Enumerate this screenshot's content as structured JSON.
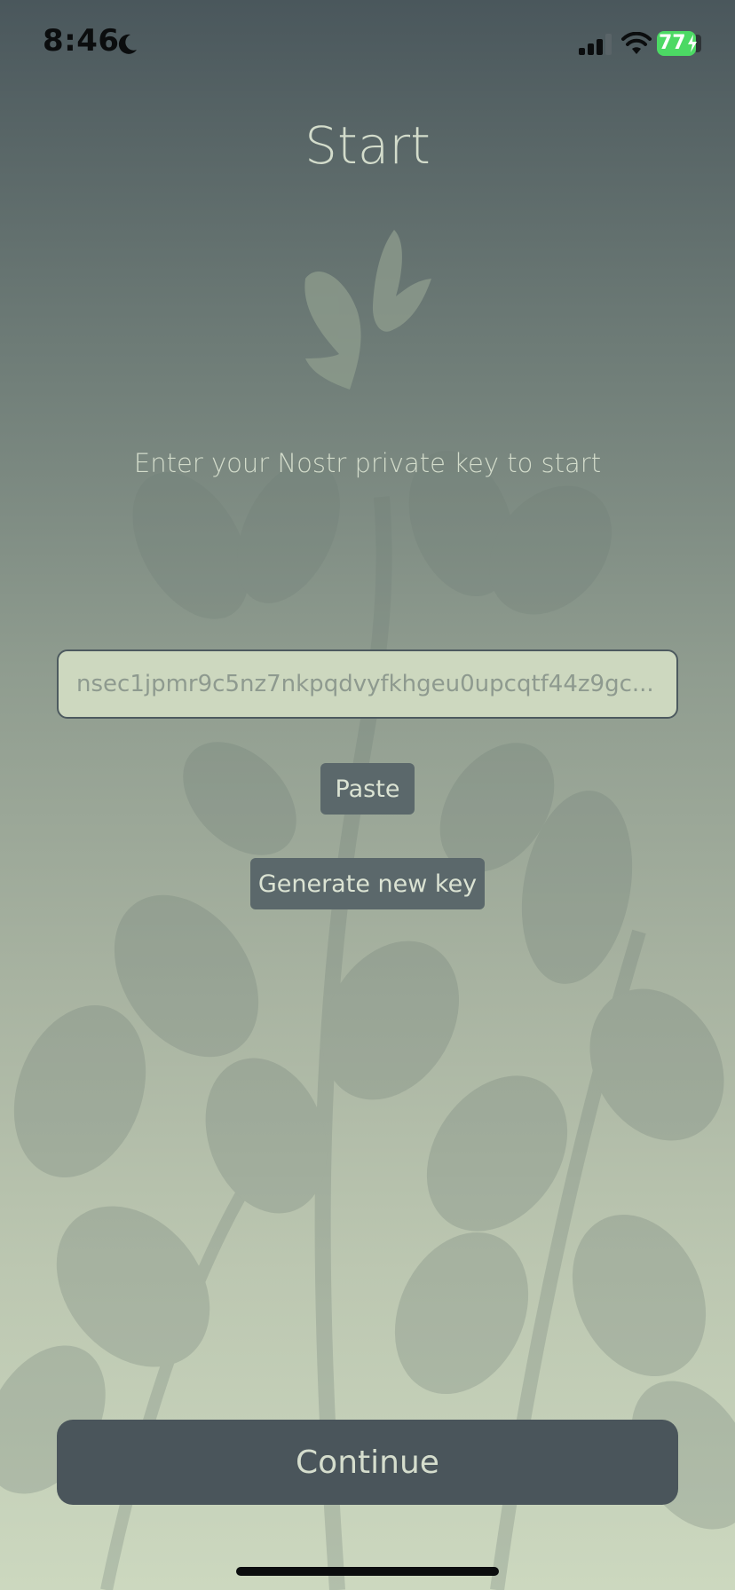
{
  "status_bar": {
    "time": "8:46",
    "battery_level": "77",
    "icons": [
      "moon-icon",
      "signal-icon",
      "wifi-icon",
      "battery-icon",
      "charging-bolt-icon"
    ]
  },
  "onboarding": {
    "title": "Start",
    "logo": "leaf-logo-icon",
    "subtitle": "Enter your Nostr private key to start",
    "key_field": {
      "value": "nsec1jpmr9c5nz7nkpqdvyfkhgeu0upcqtf44z9gc..."
    },
    "paste_label": "Paste",
    "generate_label": "Generate new key",
    "continue_label": "Continue"
  },
  "colors": {
    "background_top": "#4a575c",
    "background_bottom": "#ccd8bf",
    "button": "#4a555b",
    "text_light": "#d3dccb"
  }
}
